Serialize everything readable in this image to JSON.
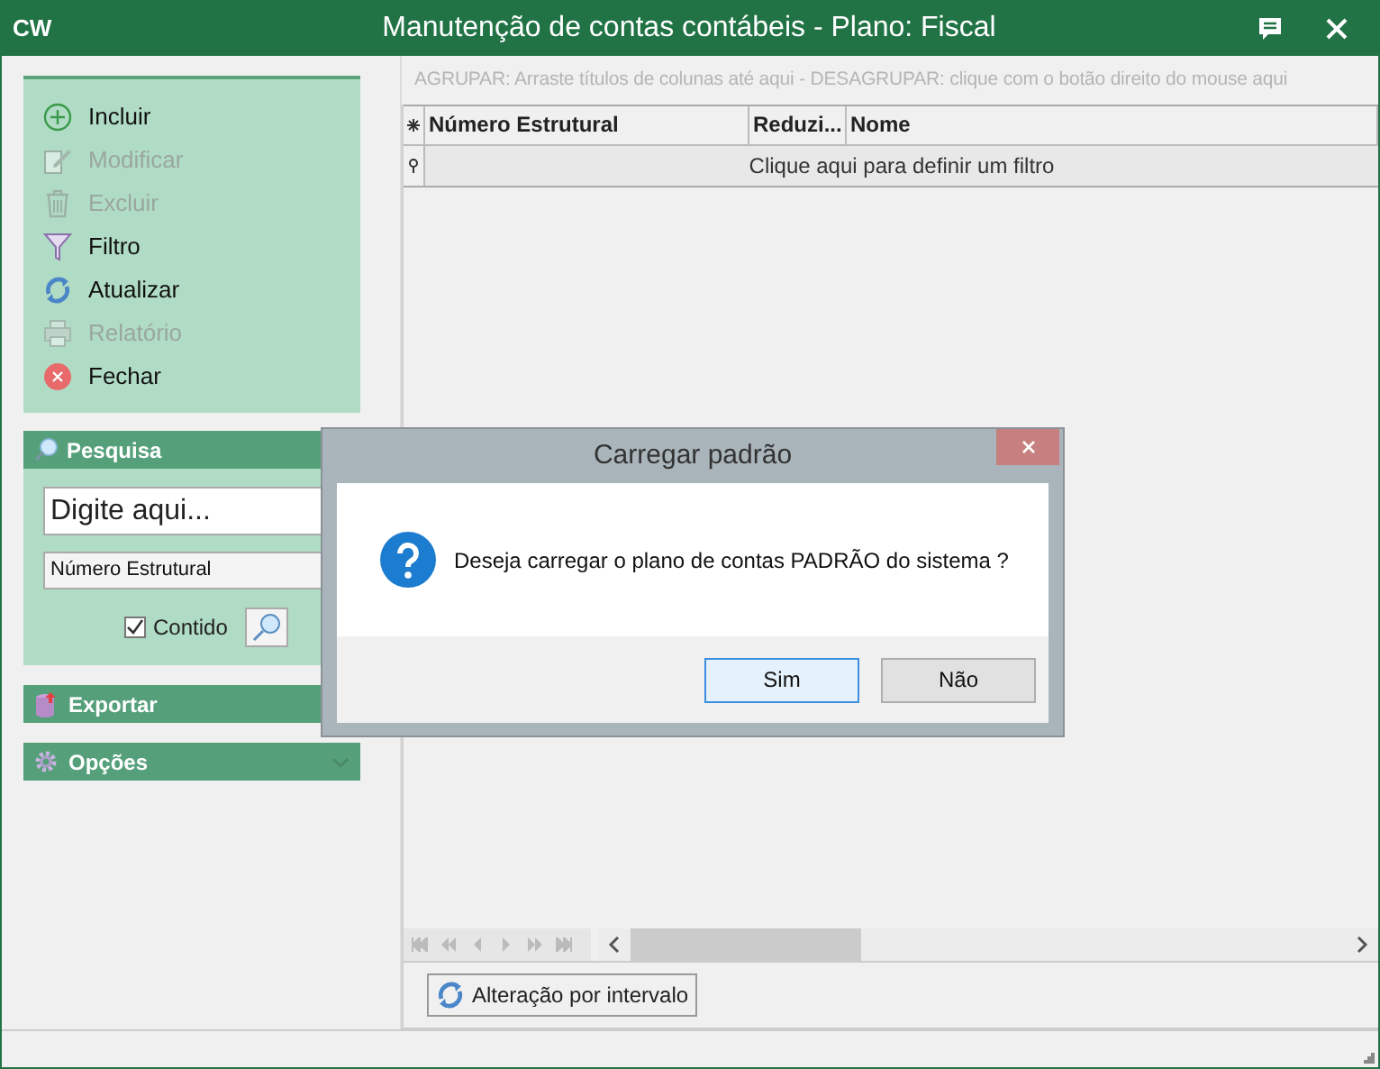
{
  "window": {
    "logo": "CW",
    "title": "Manutenção de contas contábeis - Plano: Fiscal"
  },
  "actions": [
    {
      "label": "Incluir",
      "kind": "add",
      "disabled": false
    },
    {
      "label": "Modificar",
      "kind": "edit",
      "disabled": true
    },
    {
      "label": "Excluir",
      "kind": "delete",
      "disabled": true
    },
    {
      "label": "Filtro",
      "kind": "filter",
      "disabled": false
    },
    {
      "label": "Atualizar",
      "kind": "refresh",
      "disabled": false
    },
    {
      "label": "Relatório",
      "kind": "print",
      "disabled": true
    },
    {
      "label": "Fechar",
      "kind": "close",
      "disabled": false
    }
  ],
  "search": {
    "title": "Pesquisa",
    "placeholder": "Digite aqui...",
    "field": "Número Estrutural",
    "contains": {
      "label": "Contido",
      "checked": true
    }
  },
  "sections": [
    {
      "title": "Exportar",
      "kind": "export"
    },
    {
      "title": "Opções",
      "kind": "options"
    }
  ],
  "grid": {
    "group_hint": "AGRUPAR: Arraste títulos de colunas até aqui - DESAGRUPAR: clique com o botão direito do mouse aqui",
    "columns": [
      "Número Estrutural",
      "Reduzi...",
      "Nome"
    ],
    "filter_row": "Clique aqui para definir um filtro"
  },
  "bottom_button": "Alteração por intervalo",
  "dialog": {
    "title": "Carregar padrão",
    "message": "Deseja carregar o plano de contas PADRÃO do sistema ?",
    "buttons": [
      {
        "label": "Sim",
        "selected": true
      },
      {
        "label": "Não",
        "selected": false
      }
    ]
  }
}
